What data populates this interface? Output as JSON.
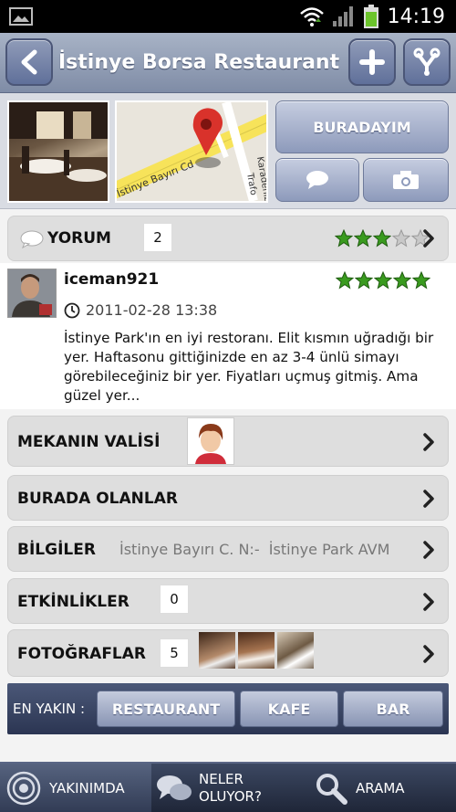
{
  "status_bar": {
    "time": "14:19"
  },
  "header": {
    "title": "İstinye Borsa Restaurant"
  },
  "map": {
    "street_main": "İstinye Bayırı Cd",
    "street_side": "Karadeniz",
    "street_side2": "Trafo"
  },
  "actions": {
    "here_label": "BURADAYIM"
  },
  "comments_row": {
    "label": "YORUM",
    "count": "2",
    "rating": 3,
    "max_rating": 5
  },
  "comment": {
    "username": "iceman921",
    "datetime": "2011-02-28 13:38",
    "rating": 5,
    "text": "İstinye Park'ın en iyi restoranı. Elit kısmın uğradığı bir yer. Haftasonu gittiğinizde en az 3-4 ünlü simayı görebileceğiniz bir yer. Fiyatları uçmuş gitmiş. Ama güzel yer..."
  },
  "rows": {
    "valet": {
      "label": "MEKANIN VALİSİ"
    },
    "here_now": {
      "label": "BURADA OLANLAR"
    },
    "info": {
      "label": "BİLGİLER",
      "value": "İstinye Bayırı C. N:-  İstinye Park AVM"
    },
    "events": {
      "label": "ETKİNLİKLER",
      "count": "0"
    },
    "photos": {
      "label": "FOTOĞRAFLAR",
      "count": "5"
    }
  },
  "nearest": {
    "label": "EN YAKIN :",
    "buttons": [
      "RESTAURANT",
      "KAFE",
      "BAR"
    ]
  },
  "tabs": [
    {
      "label": "YAKINIMDA",
      "icon": "radar-icon"
    },
    {
      "label": "NELER OLUYOR?",
      "icon": "speech-bubbles-icon"
    },
    {
      "label": "ARAMA",
      "icon": "search-icon"
    }
  ],
  "colors": {
    "header": "#8f9bb8",
    "star": "#3a9b1f",
    "nav": "#2b3552"
  }
}
